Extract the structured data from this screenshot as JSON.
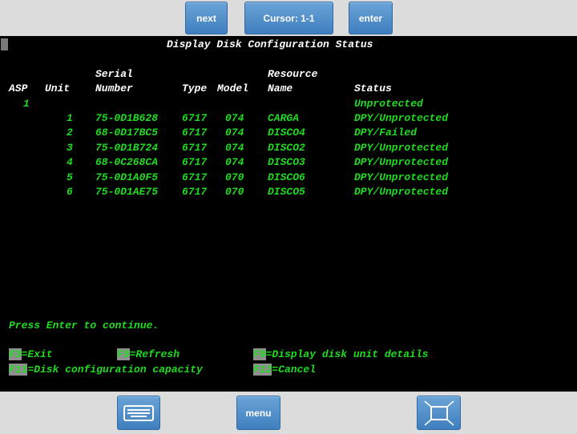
{
  "toolbar": {
    "next_label": "next",
    "cursor_label": "Cursor: 1-1",
    "enter_label": "enter",
    "menu_label": "menu"
  },
  "screen": {
    "title": "Display Disk Configuration Status",
    "headers": {
      "row1": {
        "serial": "Serial",
        "resource": "Resource"
      },
      "row2": {
        "asp": "ASP",
        "unit": "Unit",
        "serial": "Number",
        "type": "Type",
        "model": "Model",
        "resource": "Name",
        "status": "Status"
      }
    },
    "asp_row": {
      "asp": "1",
      "status": "Unprotected"
    },
    "rows": [
      {
        "unit": "1",
        "serial": "75-0D1B628",
        "type": "6717",
        "model": "074",
        "resource": "CARGA",
        "status": "DPY/Unprotected"
      },
      {
        "unit": "2",
        "serial": "68-0D17BC5",
        "type": "6717",
        "model": "074",
        "resource": "DISCO4",
        "status": "DPY/Failed"
      },
      {
        "unit": "3",
        "serial": "75-0D1B724",
        "type": "6717",
        "model": "074",
        "resource": "DISCO2",
        "status": "DPY/Unprotected"
      },
      {
        "unit": "4",
        "serial": "68-0C268CA",
        "type": "6717",
        "model": "074",
        "resource": "DISCO3",
        "status": "DPY/Unprotected"
      },
      {
        "unit": "5",
        "serial": "75-0D1A0F5",
        "type": "6717",
        "model": "070",
        "resource": "DISCO6",
        "status": "DPY/Unprotected"
      },
      {
        "unit": "6",
        "serial": "75-0D1AE75",
        "type": "6717",
        "model": "070",
        "resource": "DISCO5",
        "status": "DPY/Unprotected"
      }
    ],
    "message": "Press Enter to continue.",
    "fkeys": [
      {
        "key": "F3",
        "text": "=Exit"
      },
      {
        "key": "F5",
        "text": "=Refresh"
      },
      {
        "key": "F9",
        "text": "=Display disk unit details"
      },
      {
        "key": "F11",
        "text": "=Disk configuration capacity"
      },
      {
        "key": "F12",
        "text": "=Cancel"
      }
    ]
  },
  "colors": {
    "screen_bg": "#000000",
    "text_green": "#1fdc1f",
    "text_white": "#ffffff",
    "button_blue": "#4f8cc9"
  },
  "icons": {
    "keyboard": "keyboard-icon",
    "fullscreen": "fullscreen-icon"
  }
}
